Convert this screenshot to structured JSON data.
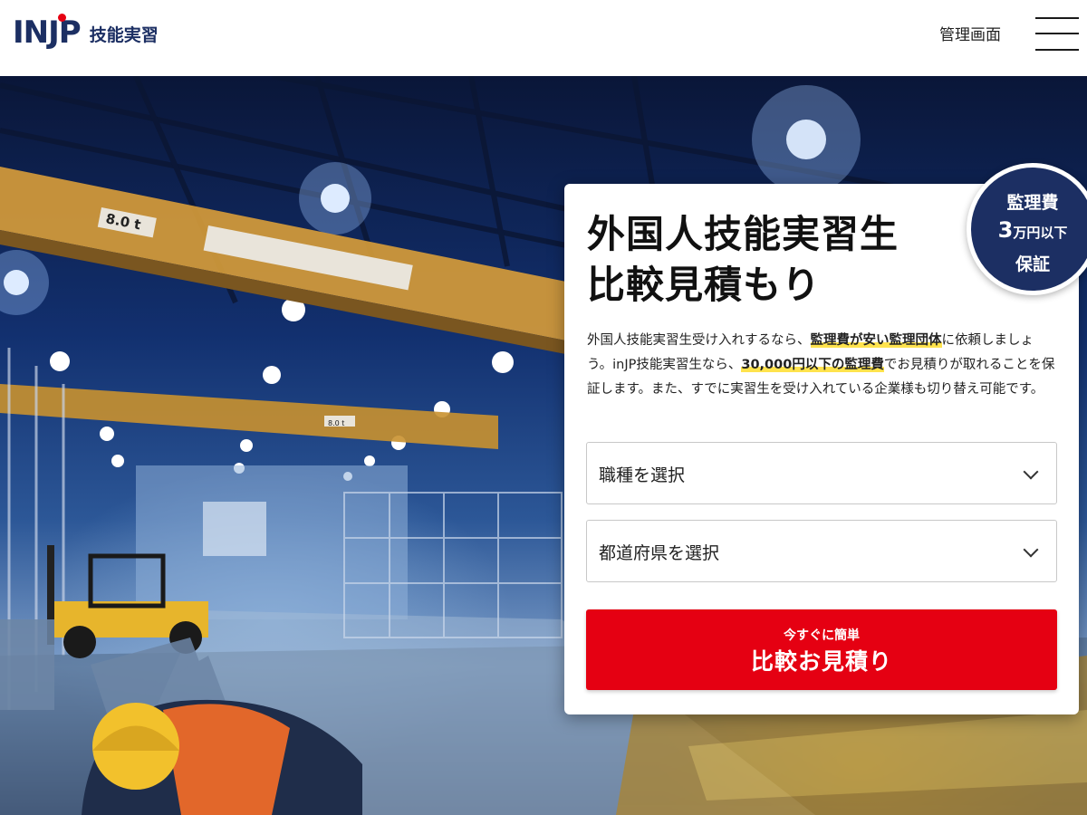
{
  "header": {
    "logo_mark": "INJP",
    "logo_sub": "技能実習",
    "admin_link": "管理画面",
    "menu_icon": "hamburger-menu-icon"
  },
  "hero": {
    "crane_labels": [
      "8.0 t",
      "8.0 t"
    ]
  },
  "badge": {
    "line1": "監理費",
    "line2_num": "3",
    "line2_text": "万円以下",
    "line3": "保証"
  },
  "card": {
    "title_line1": "外国人技能実習生",
    "title_line2": "比較見積もり",
    "desc_1": "外国人技能実習生受け入れするなら、",
    "desc_hl1": "監理費が安い監理団体",
    "desc_2": "に依頼しましょう。inJP技能実習生なら、",
    "desc_hl2": "30,000円以下の監理費",
    "desc_3": "でお見積りが取れることを保証します。また、すでに実習生を受け入れている企業様も切り替え可能です。",
    "select_job": "職種を選択",
    "select_pref": "都道府県を選択",
    "cta_sub": "今すぐに簡単",
    "cta_main": "比較お見積り"
  },
  "colors": {
    "brand_navy": "#1c2f63",
    "cta_red": "#e50012",
    "highlight_yellow": "#ffe34d"
  }
}
